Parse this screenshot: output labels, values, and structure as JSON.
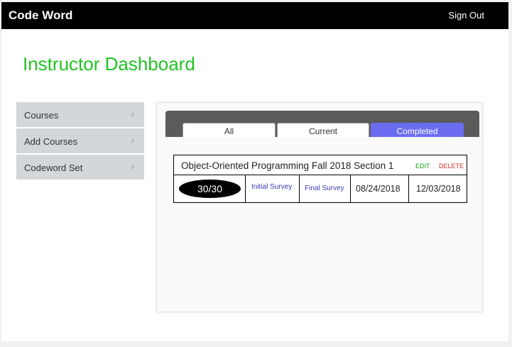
{
  "app": {
    "title": "Code Word",
    "sign_out": "Sign Out"
  },
  "page": {
    "title": "Instructor Dashboard"
  },
  "sidebar": {
    "items": [
      {
        "label": "Courses",
        "chevron": "›"
      },
      {
        "label": "Add Courses",
        "chevron": "›"
      },
      {
        "label": "Codeword Set",
        "chevron": "›"
      }
    ]
  },
  "tabs": [
    {
      "label": "All",
      "active": false
    },
    {
      "label": "Current",
      "active": false
    },
    {
      "label": "Completed",
      "active": true
    }
  ],
  "course": {
    "name": "Object-Oriented Programming Fall 2018 Section 1",
    "edit": "EDIT",
    "delete": "DELETE",
    "count": "30/30",
    "initial_survey": "Initial Survey",
    "final_survey": "Final Survey",
    "start_date": "08/24/2018",
    "end_date": "12/03/2018"
  },
  "colors": {
    "title_green": "#22c422",
    "active_tab": "#6a6cf0",
    "edit": "#16a016",
    "delete": "#d23030",
    "link": "#3a3ab8"
  }
}
